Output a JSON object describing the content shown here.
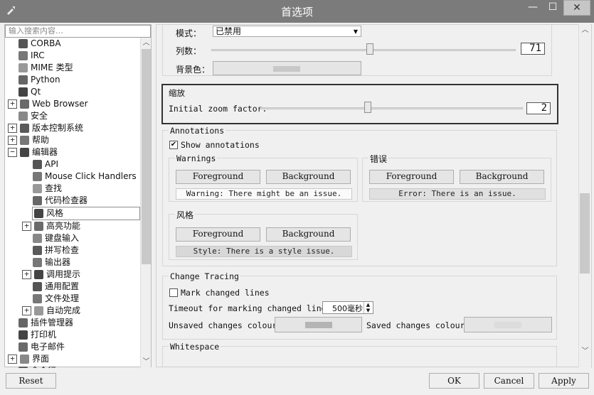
{
  "window": {
    "title": "首选项",
    "minimize_glyph": "—",
    "maximize_glyph": "☐",
    "close_glyph": "✕"
  },
  "sidebar": {
    "search_placeholder": "输入搜索内容…",
    "items": [
      {
        "label": "CORBA",
        "icon": "corba-icon",
        "expander": "",
        "indent": 0
      },
      {
        "label": "IRC",
        "icon": "irc-icon",
        "expander": "",
        "indent": 0
      },
      {
        "label": "MIME 类型",
        "icon": "mime-icon",
        "expander": "",
        "indent": 0
      },
      {
        "label": "Python",
        "icon": "python-icon",
        "expander": "",
        "indent": 0
      },
      {
        "label": "Qt",
        "icon": "qt-icon",
        "expander": "",
        "indent": 0
      },
      {
        "label": "Web Browser",
        "icon": "web-browser-icon",
        "expander": "+",
        "indent": 0
      },
      {
        "label": "安全",
        "icon": "lock-icon",
        "expander": "",
        "indent": 0
      },
      {
        "label": "版本控制系统",
        "icon": "vcs-icon",
        "expander": "+",
        "indent": 0
      },
      {
        "label": "帮助",
        "icon": "help-icon",
        "expander": "+",
        "indent": 0
      },
      {
        "label": "编辑器",
        "icon": "editor-icon",
        "expander": "−",
        "indent": 0
      },
      {
        "label": "API",
        "icon": "api-icon",
        "expander": "",
        "indent": 1
      },
      {
        "label": "Mouse Click Handlers",
        "icon": "mouse-icon",
        "expander": "",
        "indent": 1
      },
      {
        "label": "查找",
        "icon": "binoculars-icon",
        "expander": "",
        "indent": 1
      },
      {
        "label": "代码检查器",
        "icon": "bug-icon",
        "expander": "",
        "indent": 1
      },
      {
        "label": "风格",
        "icon": "style-icon",
        "expander": "",
        "indent": 1,
        "selected": true
      },
      {
        "label": "高亮功能",
        "icon": "highlight-icon",
        "expander": "+",
        "indent": 1
      },
      {
        "label": "键盘输入",
        "icon": "keyboard-icon",
        "expander": "",
        "indent": 1
      },
      {
        "label": "拼写检查",
        "icon": "spellcheck-icon",
        "expander": "",
        "indent": 1
      },
      {
        "label": "输出器",
        "icon": "exporter-icon",
        "expander": "",
        "indent": 1
      },
      {
        "label": "调用提示",
        "icon": "calltip-icon",
        "expander": "+",
        "indent": 1
      },
      {
        "label": "通用配置",
        "icon": "wrench-icon",
        "expander": "",
        "indent": 1
      },
      {
        "label": "文件处理",
        "icon": "save-icon",
        "expander": "",
        "indent": 1
      },
      {
        "label": "自动完成",
        "icon": "autocomplete-icon",
        "expander": "+",
        "indent": 1
      },
      {
        "label": "插件管理器",
        "icon": "plugin-icon",
        "expander": "",
        "indent": 0
      },
      {
        "label": "打印机",
        "icon": "printer-icon",
        "expander": "",
        "indent": 0
      },
      {
        "label": "电子邮件",
        "icon": "email-icon",
        "expander": "",
        "indent": 0
      },
      {
        "label": "界面",
        "icon": "interface-icon",
        "expander": "+",
        "indent": 0
      },
      {
        "label": "命令行",
        "icon": "terminal-icon",
        "expander": "",
        "indent": 0
      }
    ]
  },
  "top_group": {
    "mode_label": "模式：",
    "mode_value": "已禁用",
    "columns_label": "列数：",
    "columns_value": "71",
    "columns_level": 0.52,
    "bg_label": "背景色：",
    "bg_color": "#c8c8c8"
  },
  "zoom": {
    "title": "缩放",
    "label": "Initial zoom factor:",
    "value": "2",
    "level": 0.41
  },
  "annotations": {
    "title": "Annotations",
    "show_label": "Show annotations",
    "show_checked": true,
    "warnings": {
      "title": "Warnings",
      "fg": "Foreground",
      "bg": "Background",
      "preview": "Warning: There might be an issue."
    },
    "errors": {
      "title": "错误",
      "fg": "Foreground",
      "bg": "Background",
      "preview": "Error: There is an issue."
    },
    "style": {
      "title": "风格",
      "fg": "Foreground",
      "bg": "Background",
      "preview": "Style: There is a style issue."
    }
  },
  "change_tracing": {
    "title": "Change Tracing",
    "mark_label": "Mark changed lines",
    "mark_checked": false,
    "timeout_label": "Timeout for marking changed lines:",
    "timeout_value": "500毫秒",
    "unsaved_label": "Unsaved changes colour:",
    "unsaved_color": "#b4b4b4",
    "saved_label": "Saved changes colour:",
    "saved_color": "#dcdcdc"
  },
  "whitespace": {
    "title": "Whitespace"
  },
  "buttons": {
    "reset": "Reset",
    "ok": "OK",
    "cancel": "Cancel",
    "apply": "Apply"
  }
}
